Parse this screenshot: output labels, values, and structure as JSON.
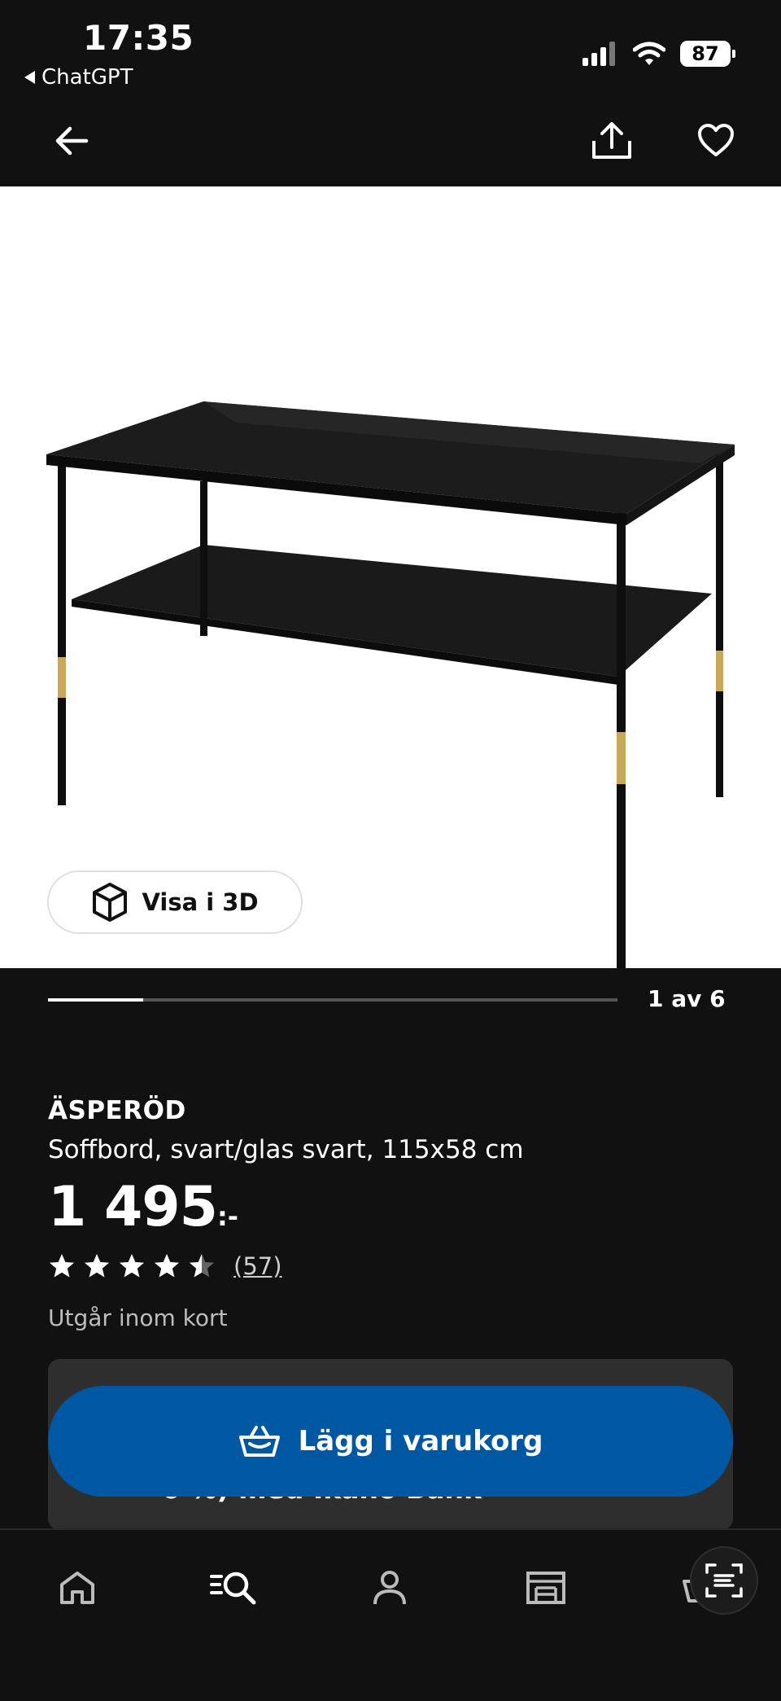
{
  "status_bar": {
    "time": "17:35",
    "back_app_label": "ChatGPT",
    "battery_level": "87"
  },
  "nav": {
    "back_icon": "arrow-left-icon",
    "share_icon": "share-icon",
    "favorite_icon": "heart-icon"
  },
  "gallery": {
    "view_3d_label": "Visa i 3D",
    "page_counter": "1 av 6",
    "progress_fraction": 0.1667
  },
  "product": {
    "brand": "ÄSPERÖD",
    "description": "Soffbord, svart/glas svart, 115x58 cm",
    "price_amount": "1 495",
    "price_suffix": ":-",
    "rating_value": 4.5,
    "rating_max": 5,
    "review_count": "(57)",
    "availability": "Utgår inom kort"
  },
  "credit": {
    "partial_text": "0 %) med Ikano Bank"
  },
  "cart": {
    "add_to_cart_label": "Lägg i varukorg"
  },
  "tab_bar": {
    "tabs": [
      "home-icon",
      "search-icon",
      "profile-icon",
      "store-icon",
      "cart-icon"
    ],
    "scan_icon": "scan-icon"
  },
  "colors": {
    "background": "#111111",
    "primary_button": "#0058a3",
    "card": "#2e2e2e"
  }
}
